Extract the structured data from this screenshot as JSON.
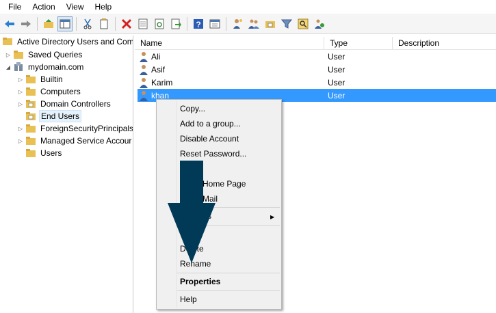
{
  "menu": [
    "File",
    "Action",
    "View",
    "Help"
  ],
  "toolbar_icons": [
    "back-arrow-icon",
    "forward-arrow-icon",
    "up-folder-icon",
    "show-tree-icon",
    "cut-icon",
    "copy-icon",
    "delete-icon",
    "properties-icon",
    "refresh-icon",
    "export-icon",
    "help-icon",
    "console-icon",
    "user-icon",
    "group-icon",
    "ou-icon",
    "filter-icon",
    "find-icon",
    "add-to-group-icon"
  ],
  "tree": {
    "root": "Active Directory Users and Com",
    "items": [
      {
        "label": "Saved Queries"
      },
      {
        "label": "mydomain.com"
      },
      {
        "label": "Builtin"
      },
      {
        "label": "Computers"
      },
      {
        "label": "Domain Controllers"
      },
      {
        "label": "End Users"
      },
      {
        "label": "ForeignSecurityPrincipals"
      },
      {
        "label": "Managed Service Accour"
      },
      {
        "label": "Users"
      }
    ]
  },
  "list": {
    "columns": [
      "Name",
      "Type",
      "Description"
    ],
    "rows": [
      {
        "name": "Ali",
        "type": "User"
      },
      {
        "name": "Asif",
        "type": "User"
      },
      {
        "name": "Karim",
        "type": "User"
      },
      {
        "name": "khan",
        "type": "User"
      }
    ]
  },
  "context_menu": {
    "copy": "Copy...",
    "add_to_group": "Add to a group...",
    "disable_account": "Disable Account",
    "reset_password": "Reset Password...",
    "move_partial": "...",
    "home_page_partial": "Home Page",
    "mail_partial": "Mail",
    "all_tasks_partial": "s",
    "cut_partial": "C",
    "delete": "Delete",
    "rename": "Rename",
    "properties": "Properties",
    "help": "Help"
  },
  "colors": {
    "selection": "#3399ff",
    "arrow": "#003a57",
    "folder": "#e8c053"
  }
}
